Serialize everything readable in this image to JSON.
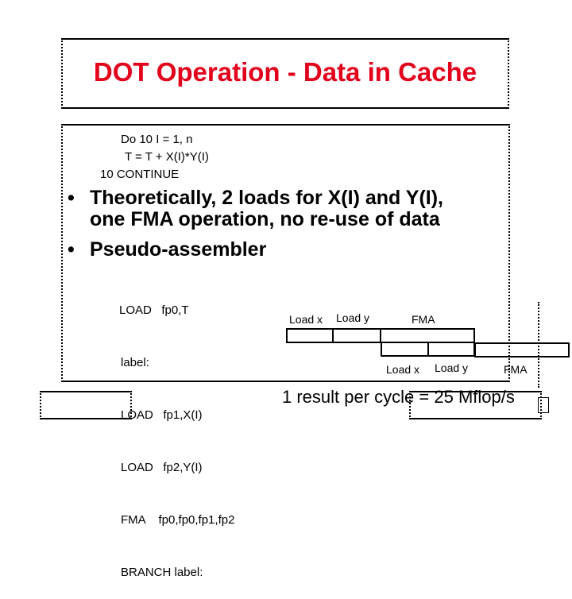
{
  "slide": {
    "title": "DOT Operation - Data in Cache",
    "title_color": "#e3001b",
    "code": [
      "Do 10 I = 1, n",
      "T = T + X(I)*Y(I)",
      "10 CONTINUE"
    ],
    "bullets": [
      {
        "line1": "Theoretically, 2 loads for X(I) and Y(I),",
        "line2": "one FMA operation, no re-use of data"
      },
      {
        "line1": "Pseudo-assembler"
      }
    ],
    "bullet_glyph": "•",
    "assembler": [
      "LOAD   fp0,T",
      "label:",
      "LOAD   fp1,X(I)",
      "LOAD   fp2,Y(I)",
      "FMA    fp0,fp0,fp1,fp2",
      "BRANCH label:"
    ],
    "pipeline": {
      "row1_labels": [
        "Load x",
        "Load y",
        "FMA"
      ],
      "row2_labels": [
        "Load x",
        "Load y",
        "FMA"
      ]
    },
    "result_text": "1 result per cycle = 25 Mflop/s"
  }
}
